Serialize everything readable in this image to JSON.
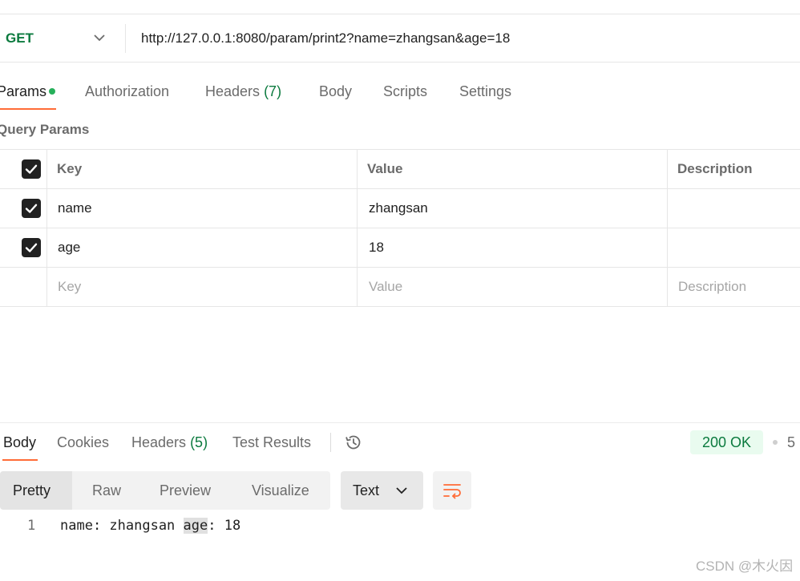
{
  "request": {
    "method": "GET",
    "url": "http://127.0.0.1:8080/param/print2?name=zhangsan&age=18"
  },
  "request_tabs": {
    "params": "Params",
    "authorization": "Authorization",
    "headers": "Headers",
    "headers_count": "(7)",
    "body": "Body",
    "scripts": "Scripts",
    "settings": "Settings"
  },
  "query_params": {
    "title": "Query Params",
    "columns": {
      "key": "Key",
      "value": "Value",
      "description": "Description"
    },
    "rows": [
      {
        "key": "name",
        "value": "zhangsan",
        "description": "",
        "checked": true
      },
      {
        "key": "age",
        "value": "18",
        "description": "",
        "checked": true
      }
    ],
    "placeholder": {
      "key": "Key",
      "value": "Value",
      "description": "Description"
    }
  },
  "response_tabs": {
    "body": "Body",
    "cookies": "Cookies",
    "headers": "Headers",
    "headers_count": "(5)",
    "test_results": "Test Results"
  },
  "response_status": {
    "code": "200 OK",
    "more": "5"
  },
  "format_tabs": {
    "pretty": "Pretty",
    "raw": "Raw",
    "preview": "Preview",
    "visualize": "Visualize",
    "text_select": "Text"
  },
  "response_body": {
    "line_number": "1",
    "before": "name: zhangsan ",
    "highlight": "age",
    "after": ": 18"
  },
  "watermark": "CSDN @木火因",
  "colors": {
    "accent": "#ff6c37",
    "method_green": "#0b7a3e",
    "status_bg": "#e9fbef",
    "dot_green": "#26b05a"
  }
}
